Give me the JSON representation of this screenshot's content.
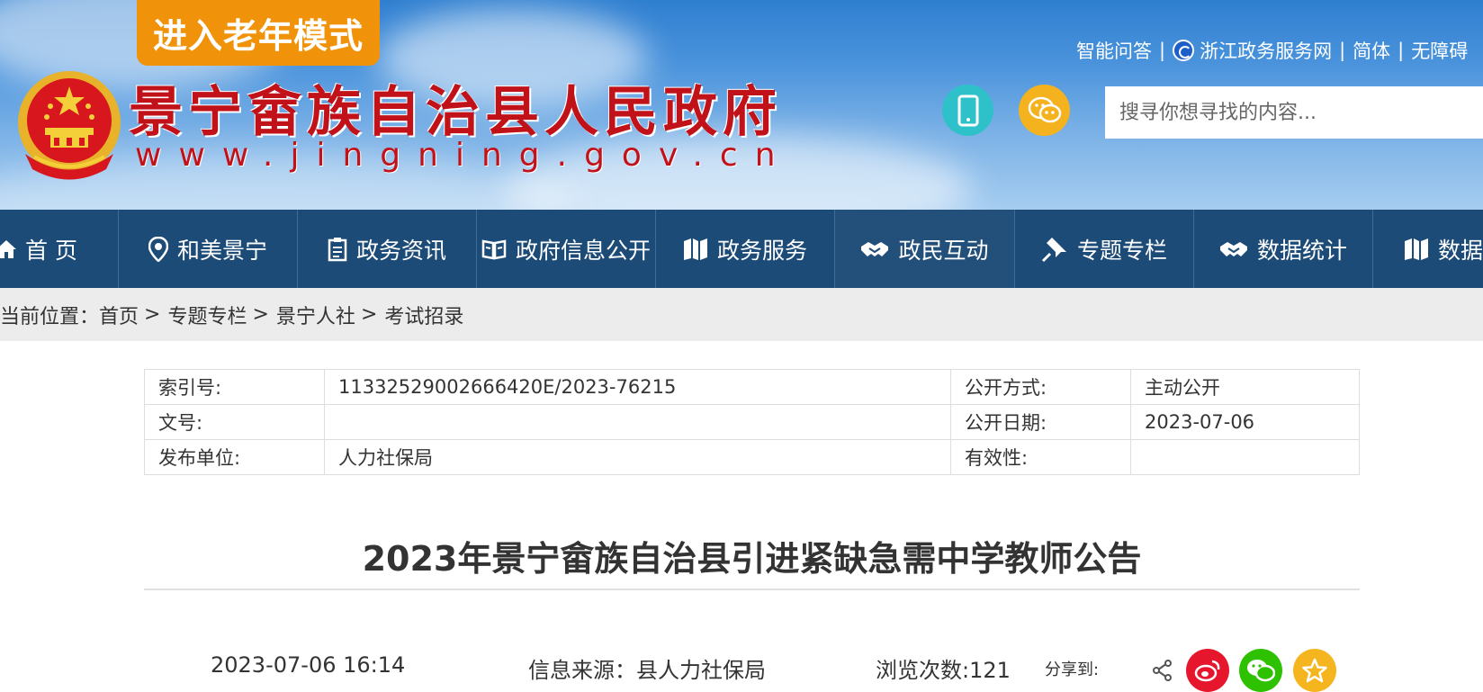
{
  "header": {
    "elder_mode": "进入老年模式",
    "site_title": "景宁畲族自治县人民政府",
    "site_url": "www.jingning.gov.cn",
    "links": {
      "qa": "智能问答",
      "zj_service": "浙江政务服务网",
      "simplified": "简体",
      "accessible": "无障碍"
    },
    "search_placeholder": "搜寻你想寻找的内容..."
  },
  "nav": {
    "items": [
      {
        "label": "首 页",
        "icon": "home-icon"
      },
      {
        "label": "和美景宁",
        "icon": "location-pin-icon"
      },
      {
        "label": "政务资讯",
        "icon": "clipboard-icon"
      },
      {
        "label": "政府信息公开",
        "icon": "book-icon"
      },
      {
        "label": "政务服务",
        "icon": "map-icon"
      },
      {
        "label": "政民互动",
        "icon": "handshake-icon"
      },
      {
        "label": "专题专栏",
        "icon": "pin-icon"
      },
      {
        "label": "数据统计",
        "icon": "handshake-icon"
      },
      {
        "label": "数据",
        "icon": "map-icon"
      }
    ]
  },
  "breadcrumb": {
    "prefix": "当前位置：",
    "items": [
      "首页",
      "专题专栏",
      "景宁人社",
      "考试招录"
    ]
  },
  "meta": {
    "index_label": "索引号:",
    "index_value": "11332529002666420E/2023-76215",
    "method_label": "公开方式:",
    "method_value": "主动公开",
    "doc_label": "文号:",
    "doc_value": "",
    "date_label": "公开日期:",
    "date_value": "2023-07-06",
    "publisher_label": "发布单位:",
    "publisher_value": "人力社保局",
    "validity_label": "有效性:",
    "validity_value": ""
  },
  "article": {
    "title": "2023年景宁畲族自治县引进紧缺急需中学教师公告",
    "datetime": "2023-07-06 16:14",
    "source": "信息来源：县人力社保局",
    "views": "浏览次数:121",
    "share_label": "分享到:"
  },
  "colors": {
    "nav_bg": "#1d4b78",
    "elder_btn": "#f0930a",
    "title_red": "#c1121a",
    "weibo": "#e6162d",
    "wechat": "#2dc100",
    "favorite": "#f5b51f"
  }
}
